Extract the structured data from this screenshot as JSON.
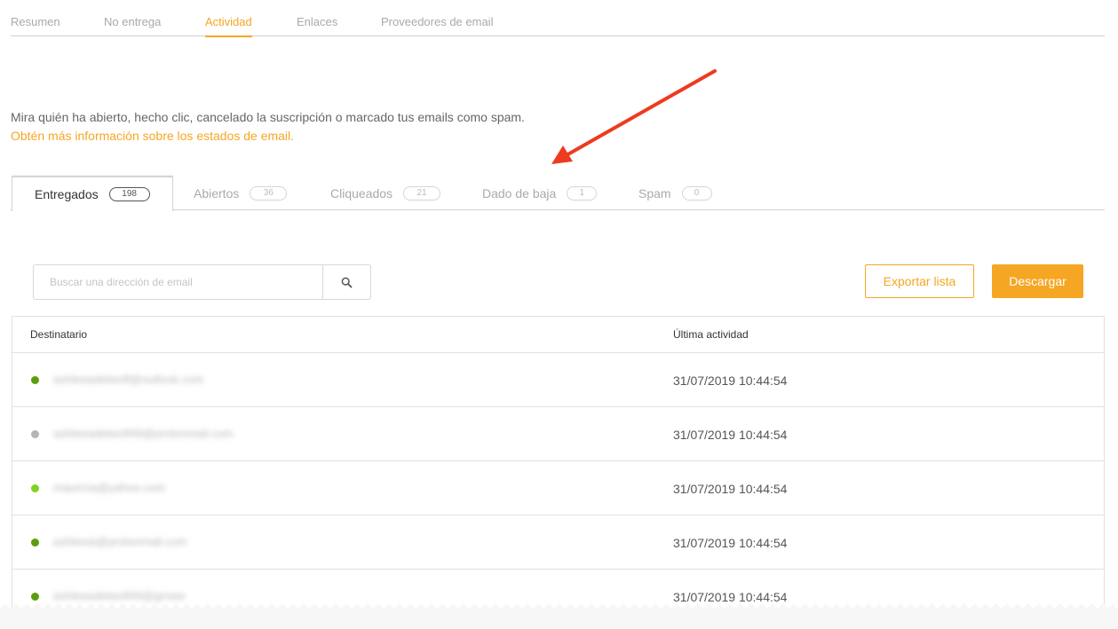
{
  "top_nav": {
    "items": [
      {
        "label": "Resumen"
      },
      {
        "label": "No entrega"
      },
      {
        "label": "Actividad"
      },
      {
        "label": "Enlaces"
      },
      {
        "label": "Proveedores de email"
      }
    ],
    "active": "Actividad"
  },
  "description": "Mira quién ha abierto, hecho clic, cancelado la suscripción o marcado tus emails como spam.",
  "info_link": "Obtén más información sobre los estados de email.",
  "status_tabs": [
    {
      "label": "Entregados",
      "count": "198"
    },
    {
      "label": "Abiertos",
      "count": "36"
    },
    {
      "label": "Cliqueados",
      "count": "21"
    },
    {
      "label": "Dado de baja",
      "count": "1"
    },
    {
      "label": "Spam",
      "count": "0"
    }
  ],
  "active_status_tab": "Entregados",
  "search": {
    "placeholder": "Buscar una dirección de email",
    "icon": "search-icon"
  },
  "buttons": {
    "export": "Exportar lista",
    "download": "Descargar"
  },
  "table": {
    "columns": [
      "Destinatario",
      "Última actividad"
    ],
    "rows": [
      {
        "email": "ashleeadelwolf@outlook.com",
        "status_color": "#5a9e0f",
        "last_activity": "31/07/2019 10:44:54"
      },
      {
        "email": "ashleeadelwolf49@protonmail.com",
        "status_color": "#b5b5b5",
        "last_activity": "31/07/2019 10:44:54"
      },
      {
        "email": "mauricia@yahoo.com",
        "status_color": "#7ed321",
        "last_activity": "31/07/2019 10:44:54"
      },
      {
        "email": "ashleeai@protonmail.com",
        "status_color": "#5a9e0f",
        "last_activity": "31/07/2019 10:44:54"
      },
      {
        "email": "ashleeadelwolf49@gmaw",
        "status_color": "#5a9e0f",
        "last_activity": "31/07/2019 10:44:54"
      }
    ]
  },
  "colors": {
    "accent": "#f5a623",
    "annotation_arrow": "#ee3a1f"
  }
}
